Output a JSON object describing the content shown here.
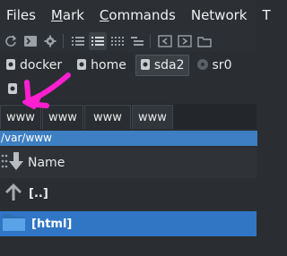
{
  "menu": {
    "items": [
      {
        "label": "Files"
      },
      {
        "label": "Mark",
        "underline": "M",
        "rest": "ark"
      },
      {
        "label": "Commands",
        "underline": "C",
        "rest": "ommands"
      },
      {
        "label": "Network"
      },
      {
        "label": "T"
      }
    ]
  },
  "toolbar": {
    "icons": [
      "refresh-icon",
      "terminal-icon",
      "gear-icon",
      "list-brief-icon",
      "list-detailed-icon",
      "thumbnails-icon",
      "tree-icon",
      "copy-icon",
      "move-icon",
      "folder-icon"
    ]
  },
  "drives": [
    {
      "label": "docker"
    },
    {
      "label": "home"
    },
    {
      "label": "sda2"
    },
    {
      "label": "sr0"
    }
  ],
  "tabs": [
    {
      "label": "www"
    },
    {
      "label": "www"
    },
    {
      "label": "www"
    },
    {
      "label": "www"
    }
  ],
  "path": "/var/www",
  "columns": {
    "name": "Name"
  },
  "rows": [
    {
      "label": "[..]"
    },
    {
      "label": "[html]"
    }
  ],
  "colors": {
    "accent": "#3d7fc2",
    "selection": "#3176c4",
    "annotation": "#ff1fd0"
  }
}
